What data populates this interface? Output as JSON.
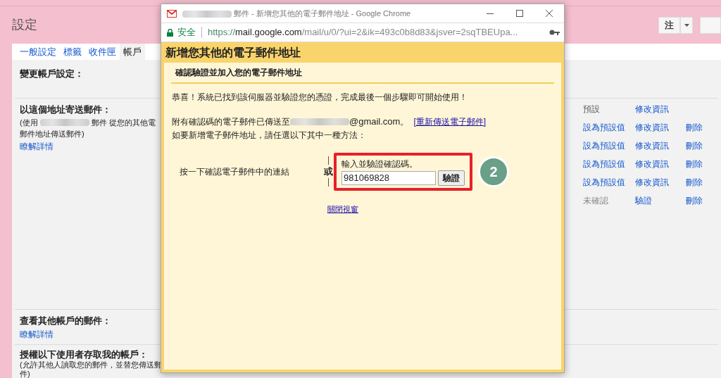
{
  "page": {
    "title": "設定",
    "header_buttons": [
      {
        "label": "注",
        "dropdown": true
      },
      {
        "dropdown": false
      }
    ]
  },
  "tabs": [
    {
      "label": "一般設定",
      "selected": false
    },
    {
      "label": "標籤",
      "selected": false
    },
    {
      "label": "收件匣",
      "selected": false
    },
    {
      "label": "帳戶",
      "selected": true
    }
  ],
  "change_settings": {
    "title": "變更帳戶設定："
  },
  "send_as": {
    "title": "以這個地址寄送郵件：",
    "desc_prefix": "(使用",
    "desc_suffix": "郵件 從您的其他電",
    "desc_line2": "郵件地址傳送郵件)",
    "link": "瞭解詳情",
    "rows": [
      {
        "action": {
          "label": "預設",
          "kind": "text"
        },
        "edit": {
          "label": "修改資訊"
        }
      },
      {
        "action": {
          "label": "設為預設值",
          "kind": "link"
        },
        "edit": {
          "label": "修改資訊"
        },
        "delete": "刪除"
      },
      {
        "action": {
          "label": "設為預設值",
          "kind": "link"
        },
        "edit": {
          "label": "修改資訊"
        },
        "delete": "刪除"
      },
      {
        "action": {
          "label": "設為預設值",
          "kind": "link"
        },
        "edit": {
          "label": "修改資訊"
        },
        "delete": "刪除"
      },
      {
        "action": {
          "label": "設為預設值",
          "kind": "link"
        },
        "edit": {
          "label": "修改資訊"
        },
        "delete": "刪除"
      },
      {
        "action": {
          "label": "未確認",
          "kind": "text"
        },
        "edit": {
          "label": "驗證"
        },
        "delete": "刪除"
      }
    ]
  },
  "check_mail": {
    "title": "查看其他帳戶的郵件：",
    "link": "瞭解詳情"
  },
  "grant_access": {
    "title": "授權以下使用者存取我的帳戶：",
    "desc_line1": "(允許其他人讀取您的郵件，並替您傳送郵",
    "desc_line2": "件)"
  },
  "popup": {
    "window_title": "郵件 - 新增您其他的電子郵件地址 - Google Chrome",
    "security": "安全",
    "url_scheme": "https://",
    "url_host": "mail.google.com",
    "url_path": "/mail/u/0/?ui=2&ik=493c0b8d83&jsver=2sqTBEUpa...",
    "heading": "新增您其他的電子郵件地址",
    "subheading": "確認驗證並加入您的電子郵件地址",
    "congrats": "恭喜！系統已找到該伺服器並驗證您的憑證，完成最後一個步驟即可開始使用！",
    "sent_prefix": "附有確認碼的電子郵件已傳送至",
    "sent_suffix": "@gmail.com。",
    "resend_link": "[重新傳送電子郵件]",
    "choose": "如要新增電子郵件地址，請任選以下其中一種方法：",
    "option_link": "按一下確認電子郵件中的連結",
    "or": "或",
    "code_label": "輸入並驗證確認碼。",
    "code_value": "981069828",
    "verify_button": "驗證",
    "step_badge": "2",
    "close_link": "關閉視窗"
  }
}
